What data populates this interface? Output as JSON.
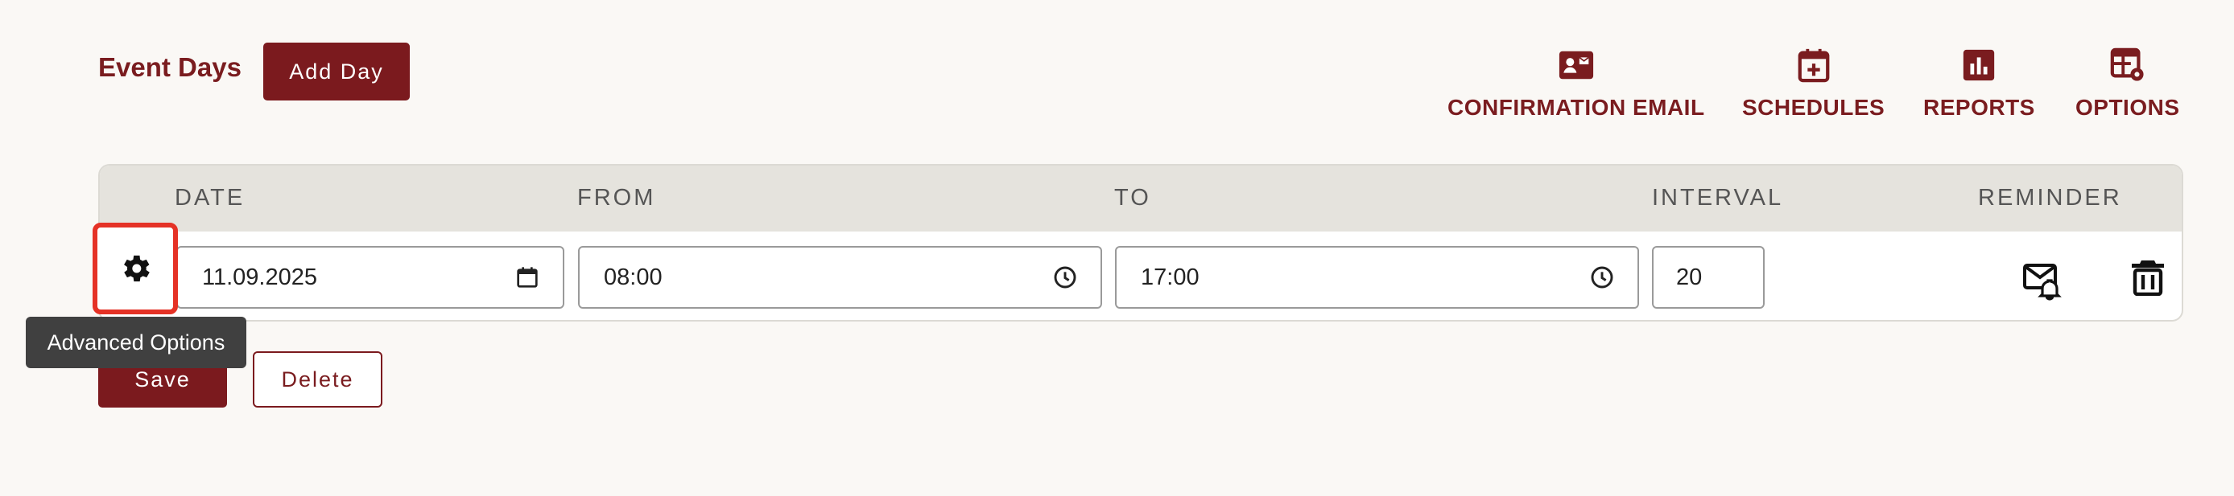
{
  "header": {
    "title": "Event Days",
    "add_day_label": "Add Day"
  },
  "nav": [
    {
      "label": "CONFIRMATION EMAIL",
      "icon": "contact-card-icon"
    },
    {
      "label": "SCHEDULES",
      "icon": "calendar-add-icon"
    },
    {
      "label": "REPORTS",
      "icon": "bar-chart-icon"
    },
    {
      "label": "OPTIONS",
      "icon": "table-settings-icon"
    }
  ],
  "table": {
    "columns": [
      "DATE",
      "FROM",
      "TO",
      "INTERVAL",
      "REMINDER"
    ],
    "row": {
      "date": "11.09.2025",
      "from": "08:00",
      "to": "17:00",
      "interval": "20"
    }
  },
  "tooltip": "Advanced Options",
  "actions": {
    "save_label": "Save",
    "delete_label": "Delete"
  },
  "colors": {
    "brand": "#7b1a1e",
    "header_bg": "#e5e3dd",
    "highlight": "#e53226"
  }
}
